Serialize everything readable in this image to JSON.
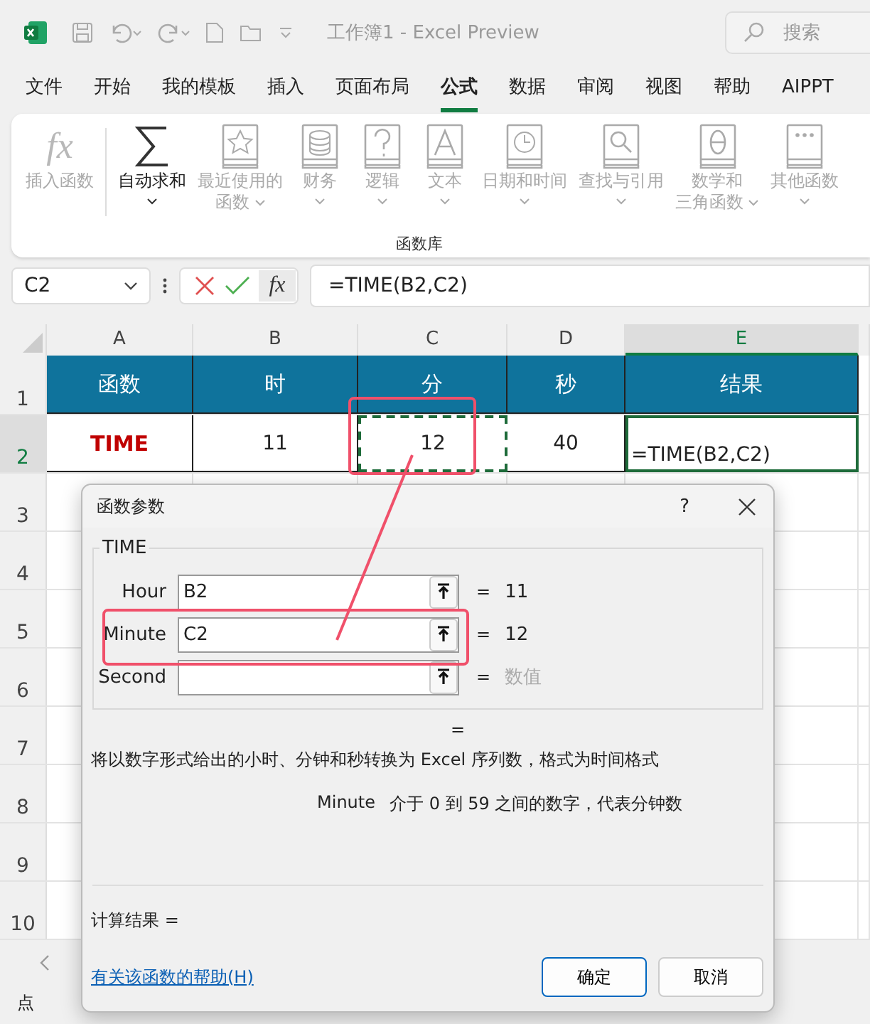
{
  "title_bar": {
    "title": "工作簿1  -  Excel Preview",
    "search_placeholder": "搜索"
  },
  "menu_tabs": [
    {
      "label": "文件",
      "selected": false
    },
    {
      "label": "开始",
      "selected": false
    },
    {
      "label": "我的模板",
      "selected": false
    },
    {
      "label": "插入",
      "selected": false
    },
    {
      "label": "页面布局",
      "selected": false
    },
    {
      "label": "公式",
      "selected": true
    },
    {
      "label": "数据",
      "selected": false
    },
    {
      "label": "审阅",
      "selected": false
    },
    {
      "label": "视图",
      "selected": false
    },
    {
      "label": "帮助",
      "selected": false
    },
    {
      "label": "AIPPT",
      "selected": false
    }
  ],
  "ribbon": {
    "group_title": "函数库",
    "items": [
      {
        "glyph": "fx",
        "lines": [
          "插入函数"
        ],
        "caret": false,
        "disabled": true
      },
      {
        "lines": [
          "自动求和"
        ],
        "caret": true,
        "disabled": false
      },
      {
        "lines": [
          "最近使用的",
          "函数"
        ],
        "caret": true,
        "disabled": true
      },
      {
        "lines": [
          "财务"
        ],
        "caret": true,
        "disabled": true
      },
      {
        "lines": [
          "逻辑"
        ],
        "caret": true,
        "disabled": true
      },
      {
        "lines": [
          "文本"
        ],
        "caret": true,
        "disabled": true
      },
      {
        "lines": [
          "日期和时间"
        ],
        "caret": true,
        "disabled": true
      },
      {
        "lines": [
          "查找与引用"
        ],
        "caret": true,
        "disabled": true
      },
      {
        "lines": [
          "数学和",
          "三角函数"
        ],
        "caret": true,
        "disabled": true
      },
      {
        "lines": [
          "其他函数"
        ],
        "caret": true,
        "disabled": true
      }
    ]
  },
  "formula_bar": {
    "name_box": "C2",
    "function_button": "fx",
    "formula": "=TIME(B2,C2)"
  },
  "sheet": {
    "columns": [
      {
        "label": "A",
        "selected": false
      },
      {
        "label": "B",
        "selected": false
      },
      {
        "label": "C",
        "selected": false
      },
      {
        "label": "D",
        "selected": false
      },
      {
        "label": "E",
        "selected": true
      }
    ],
    "rows": [
      {
        "number": "1",
        "selected": false,
        "kind": "header",
        "cells": [
          "函数",
          "时",
          "分",
          "秒",
          "结果"
        ]
      },
      {
        "number": "2",
        "selected": true,
        "kind": "data",
        "cells": [
          "TIME",
          "11",
          "12",
          "40",
          "=TIME(B2,C2)"
        ]
      },
      {
        "number": "3",
        "selected": false,
        "kind": "empty"
      },
      {
        "number": "4",
        "selected": false,
        "kind": "empty"
      },
      {
        "number": "5",
        "selected": false,
        "kind": "empty"
      },
      {
        "number": "6",
        "selected": false,
        "kind": "empty"
      },
      {
        "number": "7",
        "selected": false,
        "kind": "empty"
      },
      {
        "number": "8",
        "selected": false,
        "kind": "empty"
      },
      {
        "number": "9",
        "selected": false,
        "kind": "empty"
      },
      {
        "number": "10",
        "selected": false,
        "kind": "empty"
      }
    ]
  },
  "dialog": {
    "title": "函数参数",
    "help": "?",
    "function_name": "TIME",
    "arguments": [
      {
        "name": "Hour",
        "value": "B2",
        "equals": "=",
        "result": "11",
        "result_muted": false
      },
      {
        "name": "Minute",
        "value": "C2",
        "equals": "=",
        "result": "12",
        "result_muted": false
      },
      {
        "name": "Second",
        "equals": "=",
        "result": "数值",
        "result_muted": true
      }
    ],
    "total_equals": "=",
    "description": "将以数字形式给出的小时、分钟和秒转换为 Excel 序列数，格式为时间格式",
    "argument_help": {
      "name": "Minute",
      "text": "介于 0 到 59 之间的数字，代表分钟数"
    },
    "result_label": "计算结果 =",
    "help_link": "有关该函数的帮助(H)",
    "buttons": [
      {
        "label": "确定",
        "primary": true
      },
      {
        "label": "取消",
        "primary": false
      }
    ]
  },
  "status_bar": {
    "mode": "点"
  }
}
